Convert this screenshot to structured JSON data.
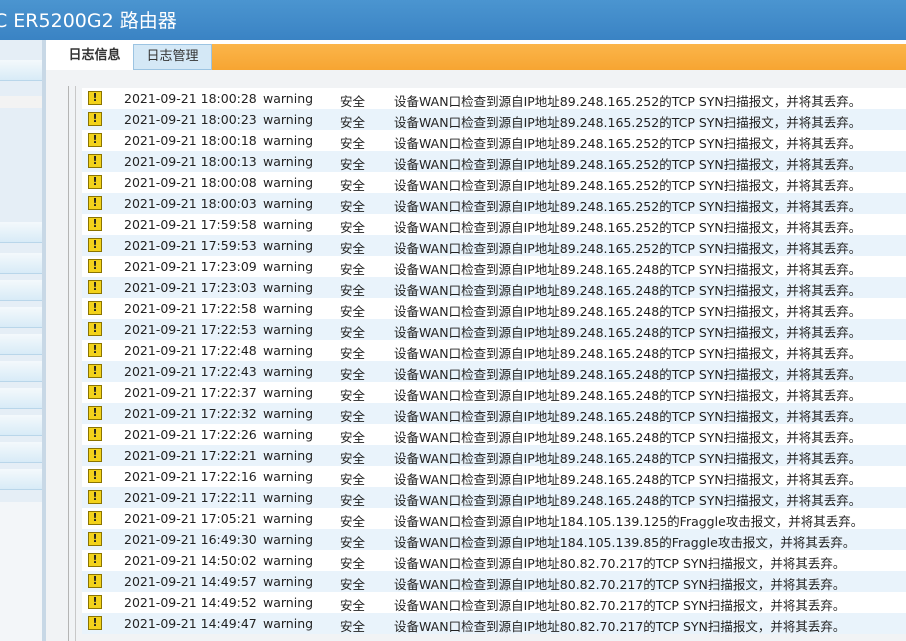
{
  "app": {
    "title": "C ER5200G2 路由器"
  },
  "tabs": [
    {
      "label": "日志信息",
      "active": true
    },
    {
      "label": "日志管理",
      "active": false
    }
  ],
  "log_rows": [
    {
      "time": "2021-09-21 18:00:28",
      "level": "warning",
      "type": "安全",
      "message": "设备WAN口检查到源自IP地址89.248.165.252的TCP SYN扫描报文，并将其丢弃。"
    },
    {
      "time": "2021-09-21 18:00:23",
      "level": "warning",
      "type": "安全",
      "message": "设备WAN口检查到源自IP地址89.248.165.252的TCP SYN扫描报文，并将其丢弃。"
    },
    {
      "time": "2021-09-21 18:00:18",
      "level": "warning",
      "type": "安全",
      "message": "设备WAN口检查到源自IP地址89.248.165.252的TCP SYN扫描报文，并将其丢弃。"
    },
    {
      "time": "2021-09-21 18:00:13",
      "level": "warning",
      "type": "安全",
      "message": "设备WAN口检查到源自IP地址89.248.165.252的TCP SYN扫描报文，并将其丢弃。"
    },
    {
      "time": "2021-09-21 18:00:08",
      "level": "warning",
      "type": "安全",
      "message": "设备WAN口检查到源自IP地址89.248.165.252的TCP SYN扫描报文，并将其丢弃。"
    },
    {
      "time": "2021-09-21 18:00:03",
      "level": "warning",
      "type": "安全",
      "message": "设备WAN口检查到源自IP地址89.248.165.252的TCP SYN扫描报文，并将其丢弃。"
    },
    {
      "time": "2021-09-21 17:59:58",
      "level": "warning",
      "type": "安全",
      "message": "设备WAN口检查到源自IP地址89.248.165.252的TCP SYN扫描报文，并将其丢弃。"
    },
    {
      "time": "2021-09-21 17:59:53",
      "level": "warning",
      "type": "安全",
      "message": "设备WAN口检查到源自IP地址89.248.165.252的TCP SYN扫描报文，并将其丢弃。"
    },
    {
      "time": "2021-09-21 17:23:09",
      "level": "warning",
      "type": "安全",
      "message": "设备WAN口检查到源自IP地址89.248.165.248的TCP SYN扫描报文，并将其丢弃。"
    },
    {
      "time": "2021-09-21 17:23:03",
      "level": "warning",
      "type": "安全",
      "message": "设备WAN口检查到源自IP地址89.248.165.248的TCP SYN扫描报文，并将其丢弃。"
    },
    {
      "time": "2021-09-21 17:22:58",
      "level": "warning",
      "type": "安全",
      "message": "设备WAN口检查到源自IP地址89.248.165.248的TCP SYN扫描报文，并将其丢弃。"
    },
    {
      "time": "2021-09-21 17:22:53",
      "level": "warning",
      "type": "安全",
      "message": "设备WAN口检查到源自IP地址89.248.165.248的TCP SYN扫描报文，并将其丢弃。"
    },
    {
      "time": "2021-09-21 17:22:48",
      "level": "warning",
      "type": "安全",
      "message": "设备WAN口检查到源自IP地址89.248.165.248的TCP SYN扫描报文，并将其丢弃。"
    },
    {
      "time": "2021-09-21 17:22:43",
      "level": "warning",
      "type": "安全",
      "message": "设备WAN口检查到源自IP地址89.248.165.248的TCP SYN扫描报文，并将其丢弃。"
    },
    {
      "time": "2021-09-21 17:22:37",
      "level": "warning",
      "type": "安全",
      "message": "设备WAN口检查到源自IP地址89.248.165.248的TCP SYN扫描报文，并将其丢弃。"
    },
    {
      "time": "2021-09-21 17:22:32",
      "level": "warning",
      "type": "安全",
      "message": "设备WAN口检查到源自IP地址89.248.165.248的TCP SYN扫描报文，并将其丢弃。"
    },
    {
      "time": "2021-09-21 17:22:26",
      "level": "warning",
      "type": "安全",
      "message": "设备WAN口检查到源自IP地址89.248.165.248的TCP SYN扫描报文，并将其丢弃。"
    },
    {
      "time": "2021-09-21 17:22:21",
      "level": "warning",
      "type": "安全",
      "message": "设备WAN口检查到源自IP地址89.248.165.248的TCP SYN扫描报文，并将其丢弃。"
    },
    {
      "time": "2021-09-21 17:22:16",
      "level": "warning",
      "type": "安全",
      "message": "设备WAN口检查到源自IP地址89.248.165.248的TCP SYN扫描报文，并将其丢弃。"
    },
    {
      "time": "2021-09-21 17:22:11",
      "level": "warning",
      "type": "安全",
      "message": "设备WAN口检查到源自IP地址89.248.165.248的TCP SYN扫描报文，并将其丢弃。"
    },
    {
      "time": "2021-09-21 17:05:21",
      "level": "warning",
      "type": "安全",
      "message": "设备WAN口检查到源自IP地址184.105.139.125的Fraggle攻击报文，并将其丢弃。"
    },
    {
      "time": "2021-09-21 16:49:30",
      "level": "warning",
      "type": "安全",
      "message": "设备WAN口检查到源自IP地址184.105.139.85的Fraggle攻击报文，并将其丢弃。"
    },
    {
      "time": "2021-09-21 14:50:02",
      "level": "warning",
      "type": "安全",
      "message": "设备WAN口检查到源自IP地址80.82.70.217的TCP SYN扫描报文，并将其丢弃。"
    },
    {
      "time": "2021-09-21 14:49:57",
      "level": "warning",
      "type": "安全",
      "message": "设备WAN口检查到源自IP地址80.82.70.217的TCP SYN扫描报文，并将其丢弃。"
    },
    {
      "time": "2021-09-21 14:49:52",
      "level": "warning",
      "type": "安全",
      "message": "设备WAN口检查到源自IP地址80.82.70.217的TCP SYN扫描报文，并将其丢弃。"
    },
    {
      "time": "2021-09-21 14:49:47",
      "level": "warning",
      "type": "安全",
      "message": "设备WAN口检查到源自IP地址80.82.70.217的TCP SYN扫描报文，并将其丢弃。"
    }
  ],
  "icons": {
    "row_icon": "warning-icon"
  },
  "colors": {
    "header": "#3a83c4",
    "tab_bar": "#f7a532",
    "row_alt": "#e9f3fb",
    "warning": "#f2d21b"
  }
}
